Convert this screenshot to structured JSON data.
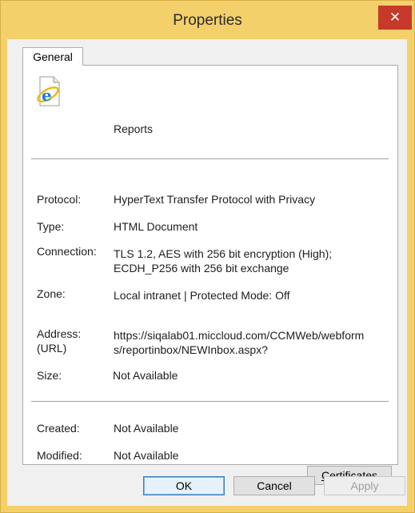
{
  "window": {
    "title": "Properties",
    "close_glyph": "✕"
  },
  "tabs": [
    {
      "label": "General",
      "selected": true
    }
  ],
  "general": {
    "icon": "internet-explorer-icon",
    "name": "Reports",
    "fields": {
      "protocol": {
        "label": "Protocol:",
        "value": "HyperText Transfer Protocol with Privacy"
      },
      "type": {
        "label": "Type:",
        "value": "HTML Document"
      },
      "connection": {
        "label": "Connection:",
        "value_lines": [
          "TLS 1.2, AES with 256 bit encryption (High);",
          "ECDH_P256 with 256 bit exchange"
        ]
      },
      "zone": {
        "label": "Zone:",
        "value": "Local intranet | Protected Mode: Off"
      },
      "address": {
        "label_lines": [
          "Address:",
          "(URL)"
        ],
        "value_lines": [
          "https://siqalab01.miccloud.com/CCMWeb/webform",
          "s/reportinbox/NEWInbox.aspx?"
        ]
      },
      "size": {
        "label": "Size:",
        "value": "Not Available"
      },
      "created": {
        "label": "Created:",
        "value": "Not Available"
      },
      "modified": {
        "label": "Modified:",
        "value": "Not Available"
      }
    },
    "certificates_button": {
      "label": "Certificates",
      "mnemonic": "C",
      "rest": "ertificates"
    }
  },
  "footer": {
    "ok_label": "OK",
    "cancel_label": "Cancel",
    "apply_label": "Apply",
    "apply_enabled": false
  },
  "colors": {
    "title_bar": "#f4d06b",
    "close_button": "#c7392b",
    "dialog_bg": "#f0f0f0",
    "panel_bg": "#ffffff"
  }
}
